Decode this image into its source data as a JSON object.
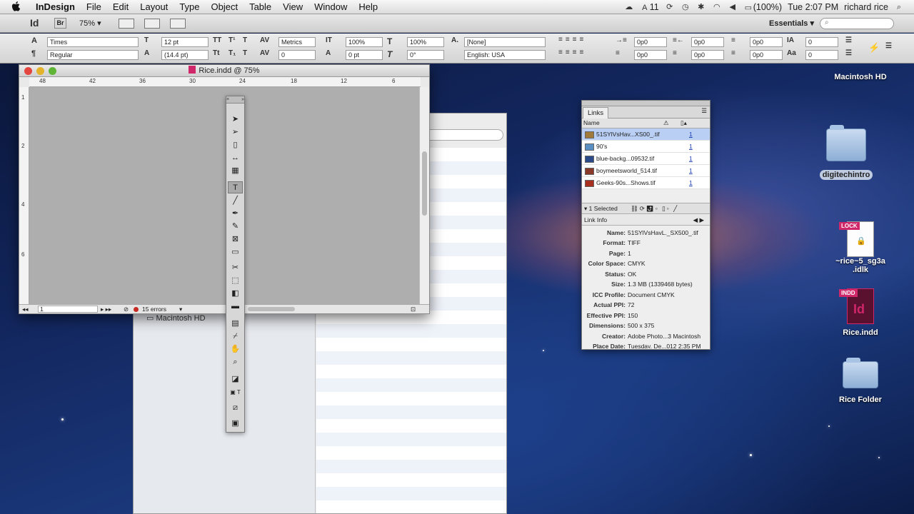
{
  "menubar": {
    "app_name": "InDesign",
    "menus": [
      "File",
      "Edit",
      "Layout",
      "Type",
      "Object",
      "Table",
      "View",
      "Window",
      "Help"
    ],
    "right": {
      "adobe_count": "11",
      "battery": "(100%)",
      "clock": "Tue 2:07 PM",
      "user": "richard rice"
    }
  },
  "control": {
    "app_logo": "Id",
    "bridge": "Br",
    "zoom": "75%",
    "workspace": "Essentials",
    "search_placeholder": ""
  },
  "char": {
    "font": "Times",
    "style": "Regular",
    "size": "12 pt",
    "leading": "(14.4 pt)",
    "kerning": "Metrics",
    "tracking": "0",
    "vscale": "100%",
    "hscale": "100%",
    "baseline": "0 pt",
    "skew": "0°",
    "char_style": "[None]",
    "language": "English: USA",
    "indent_l": "0p0",
    "indent_r": "0p0",
    "indent_fl": "0p0",
    "indent_ll": "0p0",
    "space_before": "0p0",
    "space_after": "0p0",
    "dropcap_lines": "0",
    "dropcap_chars": "0"
  },
  "docwin": {
    "title": "Rice.indd @ 75%",
    "hruler": [
      "48",
      "42",
      "36",
      "30",
      "24",
      "18",
      "12",
      "6"
    ],
    "vruler": [
      "1",
      "2",
      "4",
      "6"
    ],
    "page": "1",
    "errors": "15 errors"
  },
  "finder": {
    "sidebar_item": "Macintosh HD"
  },
  "links": {
    "tab": "Links",
    "col_name": "Name",
    "items": [
      {
        "name": "51SYlVsHav...XS00_.tif",
        "page": "1"
      },
      {
        "name": "90's",
        "page": "1"
      },
      {
        "name": "blue-backg...09532.tif",
        "page": "1"
      },
      {
        "name": "boymeetsworld_514.tif",
        "page": "1"
      },
      {
        "name": "Geeks-90s...Shows.tif",
        "page": "1"
      }
    ],
    "selected": "1 Selected",
    "info_title": "Link Info",
    "info": [
      {
        "k": "Name:",
        "v": "51SYlVsHavL._SX500_.tif"
      },
      {
        "k": "Format:",
        "v": "TIFF"
      },
      {
        "k": "Page:",
        "v": "1"
      },
      {
        "k": "Color Space:",
        "v": "CMYK"
      },
      {
        "k": "Status:",
        "v": "OK"
      },
      {
        "k": "Size:",
        "v": "1.3 MB (1339468 bytes)"
      },
      {
        "k": "ICC Profile:",
        "v": "Document CMYK"
      },
      {
        "k": "Actual PPI:",
        "v": "72"
      },
      {
        "k": "Effective PPI:",
        "v": "150"
      },
      {
        "k": "Dimensions:",
        "v": "500 x 375"
      },
      {
        "k": "Creator:",
        "v": "Adobe Photo...3 Macintosh"
      },
      {
        "k": "Place Date:",
        "v": "Tuesday, De...012 2:35 PM"
      }
    ]
  },
  "desktop": {
    "macintosh_hd": "Macintosh HD",
    "digitechintro": "digitechintro",
    "lock_badge": "LOCK",
    "lock_file_line1": "~rice~5_sg3a",
    "lock_file_line2": ".idlk",
    "indd_badge": "INDD",
    "indd_logo": "Id",
    "indd_file": "Rice.indd",
    "rice_folder": "Rice Folder"
  },
  "colors": {
    "indesign_pink": "#d0266a",
    "selection_blue": "#b9cff3",
    "error_red": "#c62a21"
  }
}
